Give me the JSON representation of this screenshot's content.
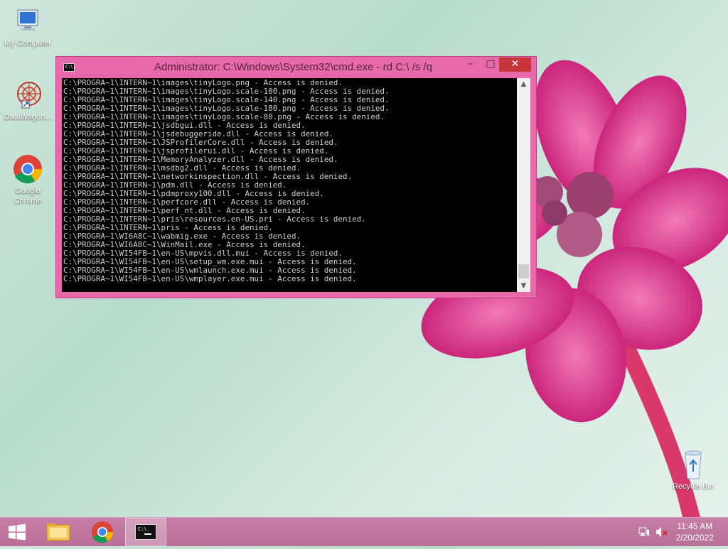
{
  "desktop": {
    "icons": [
      {
        "label": "My Computer"
      },
      {
        "label": "DataWagon..."
      },
      {
        "label": "Google Chrome"
      },
      {
        "label": "Recycle Bin"
      }
    ]
  },
  "window": {
    "title": "Administrator: C:\\Windows\\System32\\cmd.exe - rd  C:\\ /s /q",
    "app_icon_text": "C:\\.",
    "minimize": "–",
    "maximize": "□",
    "close": "✕"
  },
  "console": {
    "lines": [
      "C:\\PROGRA~1\\INTERN~1\\images\\tinyLogo.png - Access is denied.",
      "C:\\PROGRA~1\\INTERN~1\\images\\tinyLogo.scale-100.png - Access is denied.",
      "C:\\PROGRA~1\\INTERN~1\\images\\tinyLogo.scale-140.png - Access is denied.",
      "C:\\PROGRA~1\\INTERN~1\\images\\tinyLogo.scale-180.png - Access is denied.",
      "C:\\PROGRA~1\\INTERN~1\\images\\tinyLogo.scale-80.png - Access is denied.",
      "C:\\PROGRA~1\\INTERN~1\\jsdbgui.dll - Access is denied.",
      "C:\\PROGRA~1\\INTERN~1\\jsdebuggeride.dll - Access is denied.",
      "C:\\PROGRA~1\\INTERN~1\\JSProfilerCore.dll - Access is denied.",
      "C:\\PROGRA~1\\INTERN~1\\jsprofilerui.dll - Access is denied.",
      "C:\\PROGRA~1\\INTERN~1\\MemoryAnalyzer.dll - Access is denied.",
      "C:\\PROGRA~1\\INTERN~1\\msdbg2.dll - Access is denied.",
      "C:\\PROGRA~1\\INTERN~1\\networkinspection.dll - Access is denied.",
      "C:\\PROGRA~1\\INTERN~1\\pdm.dll - Access is denied.",
      "C:\\PROGRA~1\\INTERN~1\\pdmproxy100.dll - Access is denied.",
      "C:\\PROGRA~1\\INTERN~1\\perfcore.dll - Access is denied.",
      "C:\\PROGRA~1\\INTERN~1\\perf_nt.dll - Access is denied.",
      "C:\\PROGRA~1\\INTERN~1\\pris\\resources.en-US.pri - Access is denied.",
      "C:\\PROGRA~1\\INTERN~1\\pris - Access is denied.",
      "C:\\PROGRA~1\\WI6A8C~1\\wabmig.exe - Access is denied.",
      "C:\\PROGRA~1\\WI6A8C~1\\WinMail.exe - Access is denied.",
      "C:\\PROGRA~1\\WI54FB~1\\en-US\\mpvis.dll.mui - Access is denied.",
      "C:\\PROGRA~1\\WI54FB~1\\en-US\\setup_wm.exe.mui - Access is denied.",
      "C:\\PROGRA~1\\WI54FB~1\\en-US\\wmlaunch.exe.mui - Access is denied.",
      "C:\\PROGRA~1\\WI54FB~1\\en-US\\wmplayer.exe.mui - Access is denied."
    ]
  },
  "taskbar": {
    "cmd_icon_text": "C:\\.",
    "clock": {
      "time": "11:45 AM",
      "date": "2/20/2022"
    }
  },
  "colors": {
    "window_frame": "#e66aa9",
    "close_button": "#c7353b",
    "console_bg": "#000000",
    "console_text": "#d0d0d0",
    "taskbar": "#c67ea5"
  }
}
